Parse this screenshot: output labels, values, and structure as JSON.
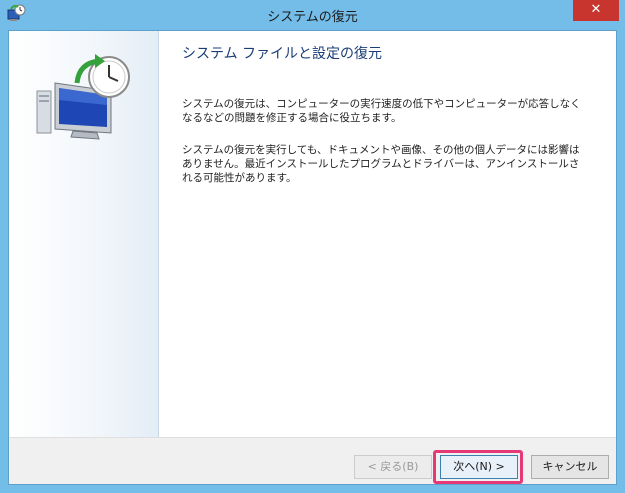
{
  "window": {
    "title": "システムの復元",
    "close_glyph": "✕"
  },
  "content": {
    "heading": "システム ファイルと設定の復元",
    "paragraph1": "システムの復元は、コンピューターの実行速度の低下やコンピューターが応答しなくなるなどの問題を修正する場合に役立ちます。",
    "paragraph2": "システムの復元を実行しても、ドキュメントや画像、その他の個人データには影響はありません。最近インストールしたプログラムとドライバーは、アンインストールされる可能性があります。"
  },
  "buttons": {
    "back": "< 戻る(B)",
    "next": "次へ(N) >",
    "cancel": "キャンセル"
  },
  "icons": {
    "app": "system-restore-icon",
    "hero": "system-restore-clock-icon"
  },
  "colors": {
    "title_bar": "#74bde9",
    "close": "#c7352e",
    "heading": "#1a3d78",
    "highlight": "#e63a78"
  }
}
